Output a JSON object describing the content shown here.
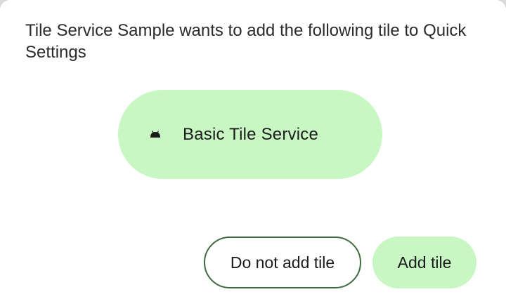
{
  "dialog": {
    "message": "Tile Service Sample wants to add the following tile to Quick Settings"
  },
  "tile": {
    "icon": "android-icon",
    "label": "Basic Tile Service"
  },
  "actions": {
    "cancel_label": "Do not add tile",
    "confirm_label": "Add tile"
  },
  "colors": {
    "tile_background": "#c8f7c4",
    "outline_border": "#3f6b3f",
    "text": "#1b1b1b"
  }
}
